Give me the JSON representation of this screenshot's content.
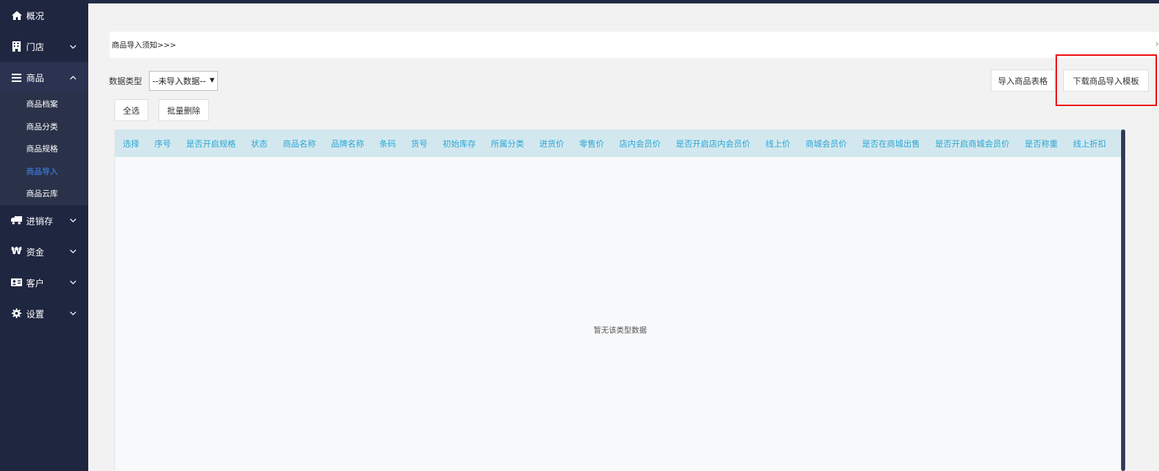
{
  "sidebar": {
    "items": [
      {
        "label": "概况",
        "icon": "home-icon",
        "chevron": ""
      },
      {
        "label": "门店",
        "icon": "building-icon",
        "chevron": "down"
      },
      {
        "label": "商品",
        "icon": "list-icon",
        "chevron": "up"
      },
      {
        "label": "进销存",
        "icon": "truck-icon",
        "chevron": "down"
      },
      {
        "label": "资金",
        "icon": "won-icon",
        "chevron": "down"
      },
      {
        "label": "客户",
        "icon": "id-card-icon",
        "chevron": "down"
      },
      {
        "label": "设置",
        "icon": "gear-icon",
        "chevron": "down"
      }
    ],
    "submenu": [
      {
        "label": "商品档案"
      },
      {
        "label": "商品分类"
      },
      {
        "label": "商品规格"
      },
      {
        "label": "商品导入",
        "current": true
      },
      {
        "label": "商品云库"
      }
    ]
  },
  "main": {
    "notice": "商品导入须知>>>",
    "filter_label": "数据类型",
    "select_value": "--未导入数据--",
    "import_button": "导入商品表格",
    "download_button": "下载商品导入模板",
    "select_all_button": "全选",
    "batch_delete_button": "批量删除",
    "table_headers": [
      "选择",
      "序号",
      "是否开启规格",
      "状态",
      "商品名称",
      "品牌名称",
      "条码",
      "货号",
      "初始库存",
      "所属分类",
      "进货价",
      "零售价",
      "店内会员价",
      "是否开启店内会员价",
      "线上价",
      "商城会员价",
      "是否在商城出售",
      "是否开启商城会员价",
      "是否称重",
      "线上折扣"
    ],
    "empty_text": "暂无该类型数据"
  },
  "colors": {
    "sidebar_bg": "#1f2640",
    "accent": "#3b8cff",
    "header_text": "#2aa6d6",
    "highlight": "#e00000"
  }
}
